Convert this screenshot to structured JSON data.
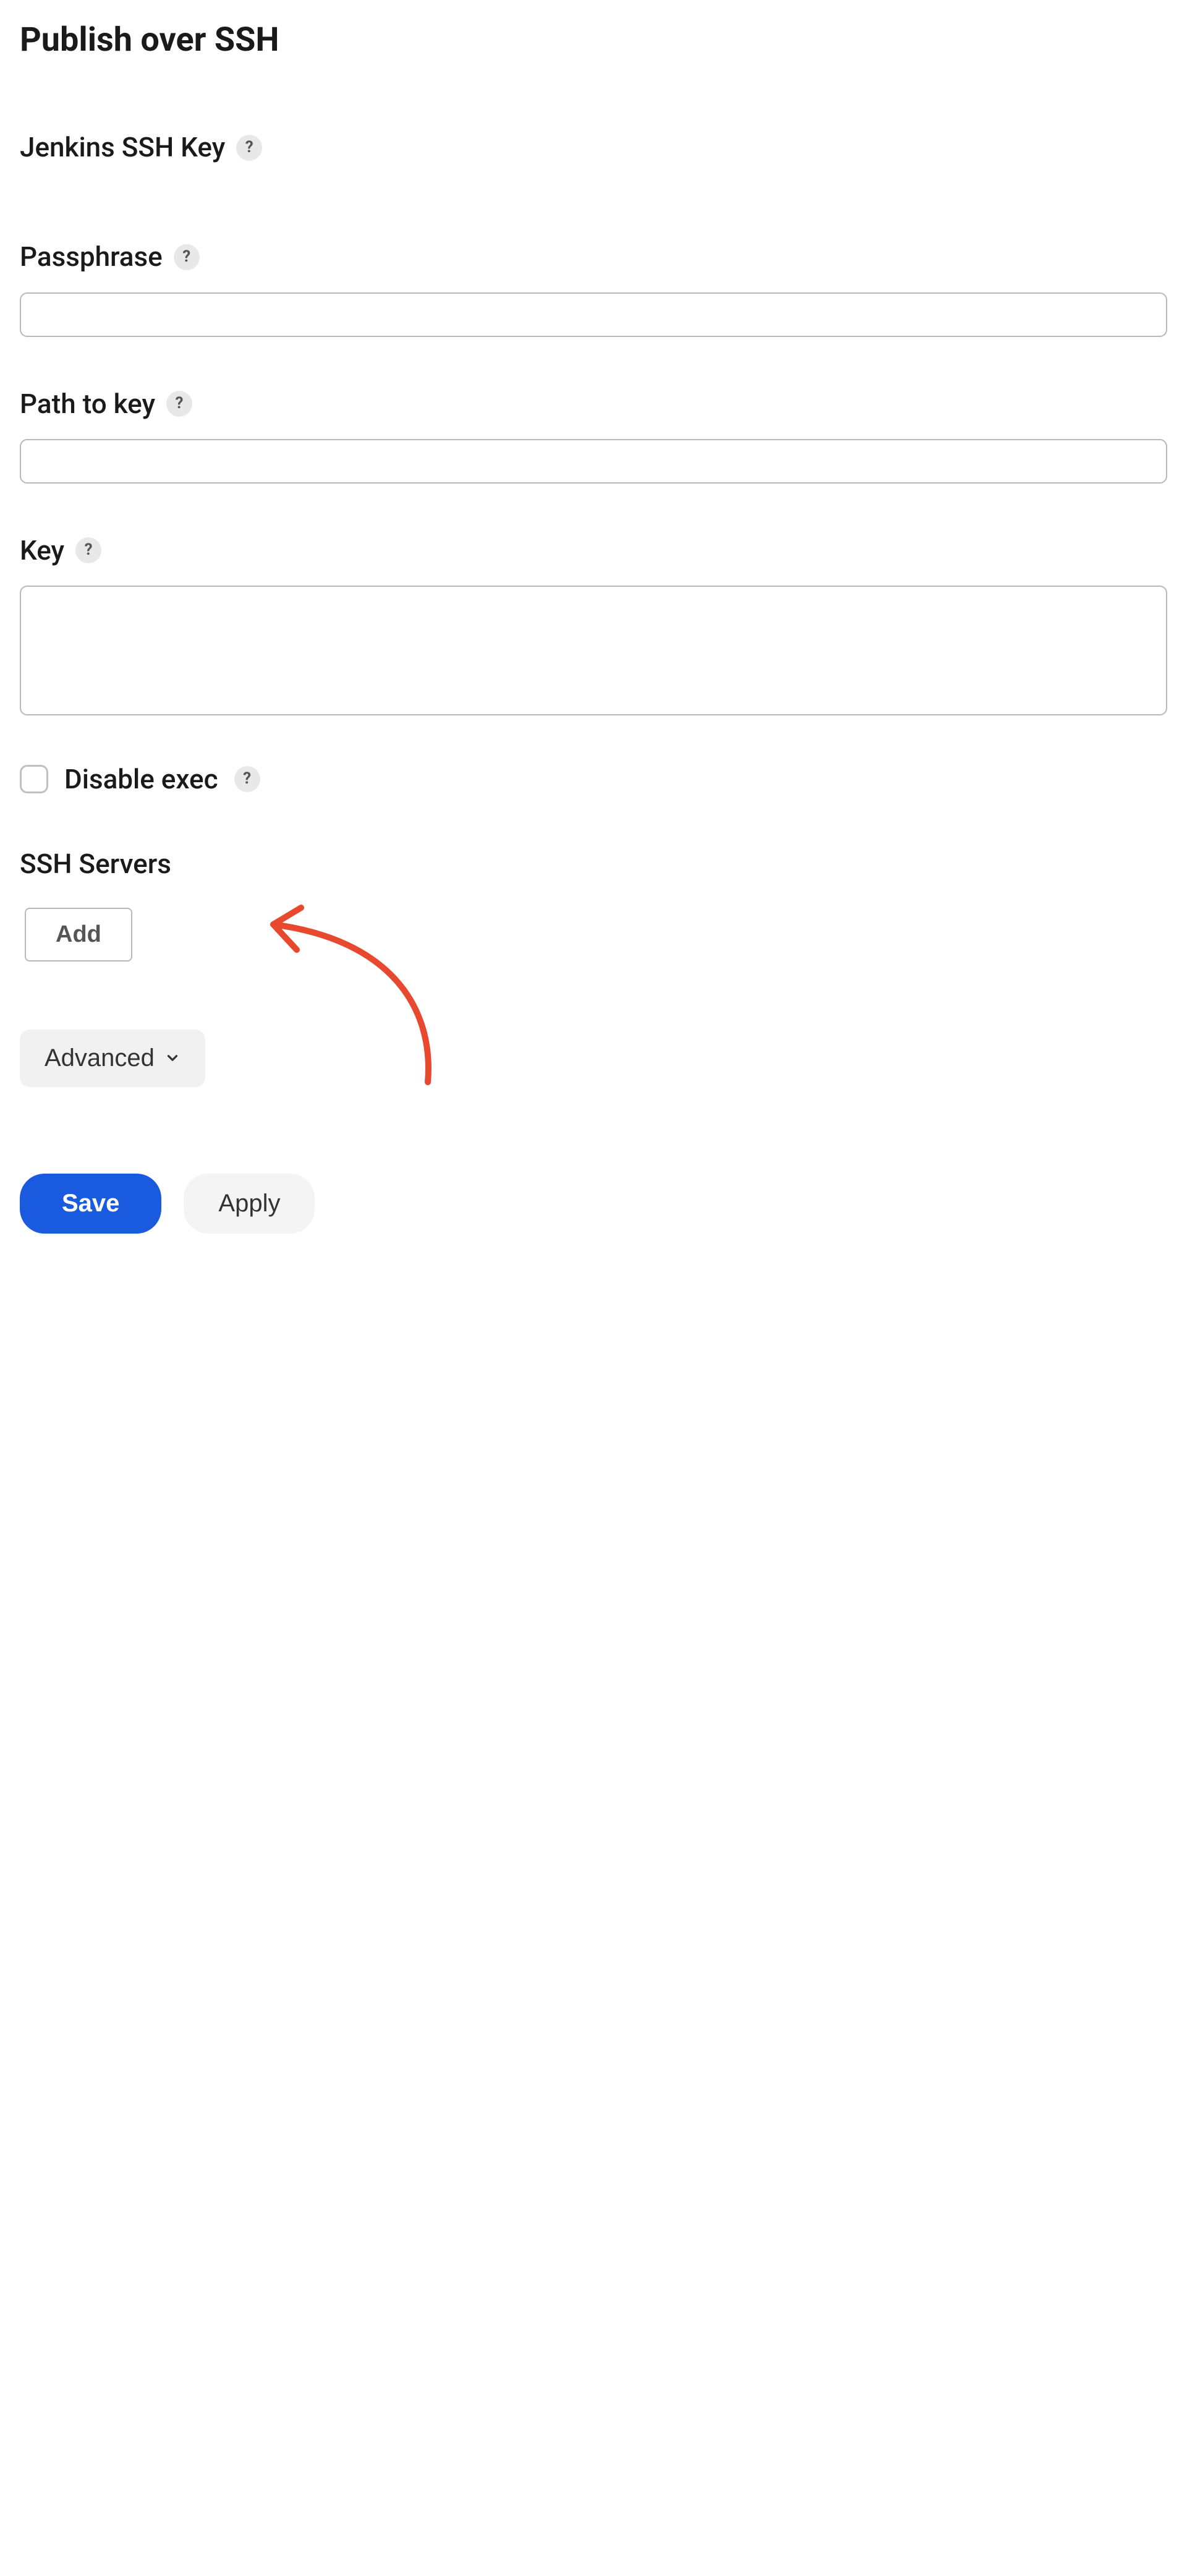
{
  "section_title": "Publish over SSH",
  "ssh_key": {
    "label": "Jenkins SSH Key"
  },
  "passphrase": {
    "label": "Passphrase",
    "value": ""
  },
  "path_to_key": {
    "label": "Path to key",
    "value": ""
  },
  "key": {
    "label": "Key",
    "value": ""
  },
  "disable_exec": {
    "label": "Disable exec",
    "checked": false
  },
  "ssh_servers": {
    "label": "SSH Servers",
    "add_label": "Add"
  },
  "advanced_label": "Advanced",
  "buttons": {
    "save": "Save",
    "apply": "Apply"
  },
  "help_glyph": "?"
}
